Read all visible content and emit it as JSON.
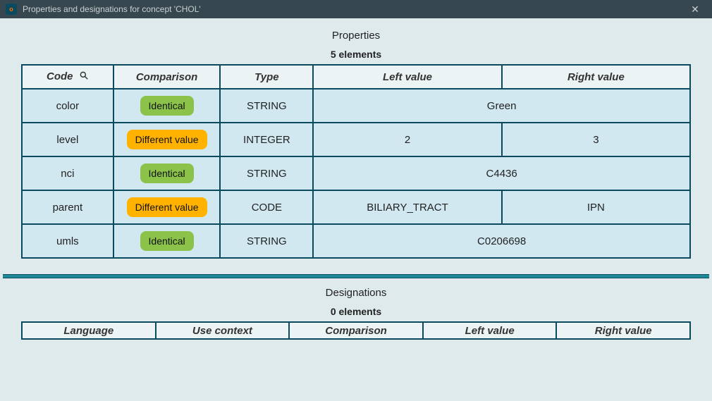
{
  "window": {
    "title": "Properties and designations for concept 'CHOL'"
  },
  "properties": {
    "title": "Properties",
    "count_label": "5 elements",
    "headers": {
      "code": "Code",
      "comparison": "Comparison",
      "type": "Type",
      "left": "Left value",
      "right": "Right value"
    },
    "rows": [
      {
        "code": "color",
        "comparison": "Identical",
        "comp_kind": "identical",
        "type": "STRING",
        "left": "Green",
        "right": "Green",
        "merged": true
      },
      {
        "code": "level",
        "comparison": "Different value",
        "comp_kind": "different",
        "type": "INTEGER",
        "left": "2",
        "right": "3",
        "merged": false
      },
      {
        "code": "nci",
        "comparison": "Identical",
        "comp_kind": "identical",
        "type": "STRING",
        "left": "C4436",
        "right": "C4436",
        "merged": true
      },
      {
        "code": "parent",
        "comparison": "Different value",
        "comp_kind": "different",
        "type": "CODE",
        "left": "BILIARY_TRACT",
        "right": "IPN",
        "merged": false
      },
      {
        "code": "umls",
        "comparison": "Identical",
        "comp_kind": "identical",
        "type": "STRING",
        "left": "C0206698",
        "right": "C0206698",
        "merged": true
      }
    ]
  },
  "designations": {
    "title": "Designations",
    "count_label": "0 elements",
    "headers": {
      "language": "Language",
      "use_context": "Use context",
      "comparison": "Comparison",
      "left": "Left value",
      "right": "Right value"
    }
  }
}
